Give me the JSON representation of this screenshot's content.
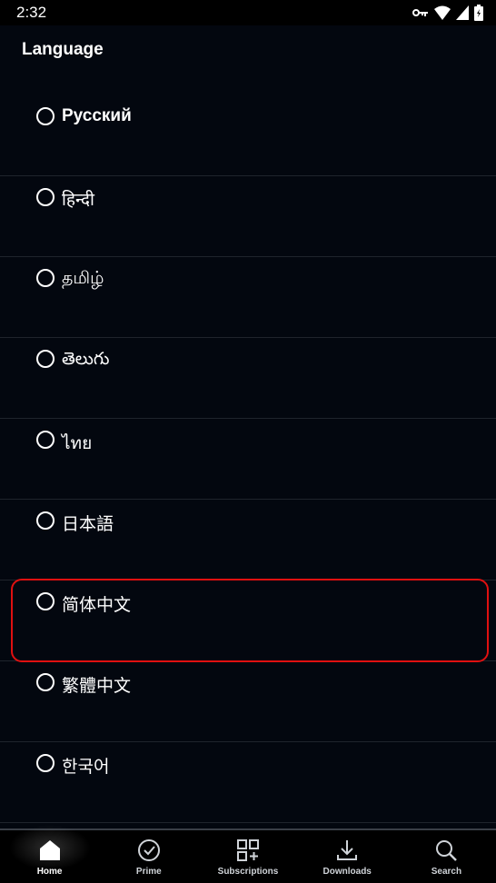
{
  "status_bar": {
    "time": "2:32"
  },
  "page": {
    "title": "Language"
  },
  "languages": [
    {
      "label": "Русский"
    },
    {
      "label": "हिन्दी"
    },
    {
      "label": "தமிழ்"
    },
    {
      "label": "తెలుగు"
    },
    {
      "label": "ไทย"
    },
    {
      "label": "日本語"
    },
    {
      "label": "简体中文"
    },
    {
      "label": "繁體中文"
    },
    {
      "label": "한국어"
    }
  ],
  "bottom_nav": {
    "items": [
      {
        "label": "Home",
        "icon": "home-icon"
      },
      {
        "label": "Prime",
        "icon": "check-circle-icon"
      },
      {
        "label": "Subscriptions",
        "icon": "grid-plus-icon"
      },
      {
        "label": "Downloads",
        "icon": "download-icon"
      },
      {
        "label": "Search",
        "icon": "search-icon"
      }
    ],
    "active_index": 0
  },
  "colors": {
    "background": "#03070f",
    "highlight": "#e01010"
  }
}
